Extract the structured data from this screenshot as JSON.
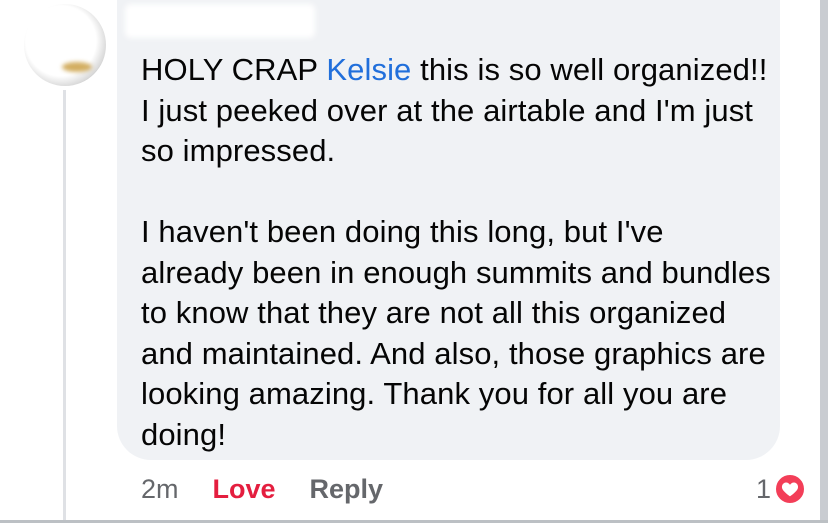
{
  "comment": {
    "author_redacted": true,
    "text_intro": "HOLY CRAP ",
    "mention": "Kelsie",
    "text_after_mention": " this is so well organized!! I just peeked over at the airtable and I'm just so impressed.",
    "paragraph_2": "I haven't been doing this long, but I've already been in enough summits and bundles to know that they are not all this organized and maintained. And also, those graphics are looking amazing. Thank you for all you are doing!",
    "mention_color": "#216fdb"
  },
  "meta": {
    "time": "2m",
    "love_label": "Love",
    "reply_label": "Reply",
    "love_color": "#e41e3f"
  },
  "reactions": {
    "count": "1",
    "icon": "heart-icon",
    "color": "#f33e58"
  }
}
